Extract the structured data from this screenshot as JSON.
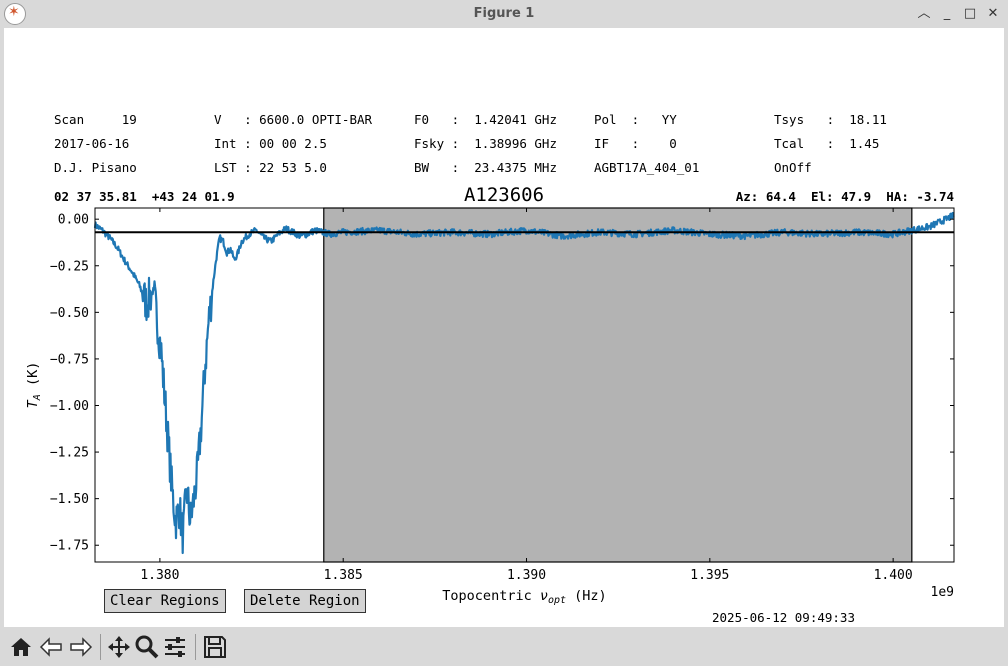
{
  "window": {
    "title": "Figure 1",
    "controls": [
      "chevron-up-icon",
      "minimize-icon",
      "maximize-icon",
      "close-icon"
    ]
  },
  "header": {
    "col1": [
      "Scan     19",
      "2017-06-16",
      "D.J. Pisano"
    ],
    "col2": [
      "V   : 6600.0 OPTI-BAR",
      "Int : 00 00 2.5",
      "LST : 22 53 5.0"
    ],
    "col3": [
      "F0   :  1.42041 GHz",
      "Fsky :  1.38996 GHz",
      "BW   :  23.4375 MHz"
    ],
    "col4": [
      "Pol  :   YY",
      "IF   :    0",
      "AGBT17A_404_01"
    ],
    "col5": [
      "Tsys   :  18.11",
      "Tcal   :  1.45",
      "OnOff"
    ],
    "object": "A123606",
    "ra_dec": "02 37 35.81  +43 24 01.9",
    "az_el_ha": "Az: 64.4  El: 47.9  HA: -3.74"
  },
  "chart_data": {
    "type": "line",
    "title": "A123606",
    "xlabel": "Topocentric ν_opt (Hz)",
    "xlabel_main": "Topocentric ",
    "xlabel_sym": "ν",
    "xlabel_sub": "opt",
    "xlabel_unit": " (Hz)",
    "ylabel_sym": "T",
    "ylabel_sub": "A",
    "ylabel_unit": " (K)",
    "offset_text": "1e9",
    "xlim": [
      1378230000.0,
      1401660000.0
    ],
    "ylim": [
      -1.84,
      0.06
    ],
    "xticks": [
      1380000000.0,
      1385000000.0,
      1390000000.0,
      1395000000.0,
      1400000000.0
    ],
    "xtick_labels": [
      "1.380",
      "1.385",
      "1.390",
      "1.395",
      "1.400"
    ],
    "yticks": [
      0.0,
      -0.25,
      -0.5,
      -0.75,
      -1.0,
      -1.25,
      -1.5,
      -1.75
    ],
    "ytick_labels": [
      "0.00",
      "−0.25",
      "−0.50",
      "−0.75",
      "−1.00",
      "−1.25",
      "−1.50",
      "−1.75"
    ],
    "baseline_y": -0.07,
    "excluded_region": [
      1384470000.0,
      1400510000.0
    ],
    "series": [
      {
        "color": "#1f77b4",
        "x": [
          1378230000.0,
          1378430000.0,
          1378630000.0,
          1378830000.0,
          1379030000.0,
          1379230000.0,
          1379430000.0,
          1379630000.0,
          1379830000.0,
          1379930000.0,
          1380030000.0,
          1380130000.0,
          1380230000.0,
          1380330000.0,
          1380430000.0,
          1380530000.0,
          1380630000.0,
          1380730000.0,
          1380830000.0,
          1380930000.0,
          1381030000.0,
          1381130000.0,
          1381230000.0,
          1381330000.0,
          1381430000.0,
          1381530000.0,
          1381630000.0,
          1381730000.0,
          1381830000.0,
          1381930000.0,
          1382030000.0,
          1382130000.0,
          1382230000.0,
          1382430000.0,
          1382630000.0,
          1382830000.0,
          1383030000.0,
          1383230000.0,
          1383430000.0,
          1383630000.0,
          1383830000.0,
          1384030000.0,
          1384230000.0,
          1384430000.0,
          1384630000.0,
          1385000000.0,
          1386000000.0,
          1387000000.0,
          1388000000.0,
          1389000000.0,
          1390000000.0,
          1391000000.0,
          1392000000.0,
          1393000000.0,
          1394000000.0,
          1395000000.0,
          1396000000.0,
          1397000000.0,
          1398000000.0,
          1399000000.0,
          1400000000.0,
          1400500000.0,
          1401000000.0,
          1401660000.0
        ],
        "y": [
          -0.03,
          -0.06,
          -0.1,
          -0.15,
          -0.22,
          -0.28,
          -0.35,
          -0.45,
          -0.38,
          -0.55,
          -0.7,
          -0.95,
          -1.2,
          -1.45,
          -1.62,
          -1.55,
          -1.7,
          -1.45,
          -1.62,
          -1.5,
          -1.35,
          -1.1,
          -0.8,
          -0.55,
          -0.38,
          -0.22,
          -0.1,
          -0.12,
          -0.18,
          -0.16,
          -0.22,
          -0.18,
          -0.12,
          -0.08,
          -0.06,
          -0.1,
          -0.12,
          -0.08,
          -0.05,
          -0.07,
          -0.09,
          -0.08,
          -0.06,
          -0.07,
          -0.08,
          -0.07,
          -0.06,
          -0.08,
          -0.07,
          -0.08,
          -0.06,
          -0.09,
          -0.07,
          -0.08,
          -0.06,
          -0.08,
          -0.09,
          -0.07,
          -0.08,
          -0.07,
          -0.08,
          -0.06,
          -0.04,
          0.02
        ]
      }
    ],
    "grid": false
  },
  "buttons": {
    "clear_regions": "Clear Regions",
    "delete_region": "Delete Region"
  },
  "timestamp": "2025-06-12 09:49:33",
  "toolbar": [
    "home-icon",
    "back-icon",
    "forward-icon",
    "pan-icon",
    "zoom-icon",
    "configure-icon",
    "save-icon"
  ]
}
